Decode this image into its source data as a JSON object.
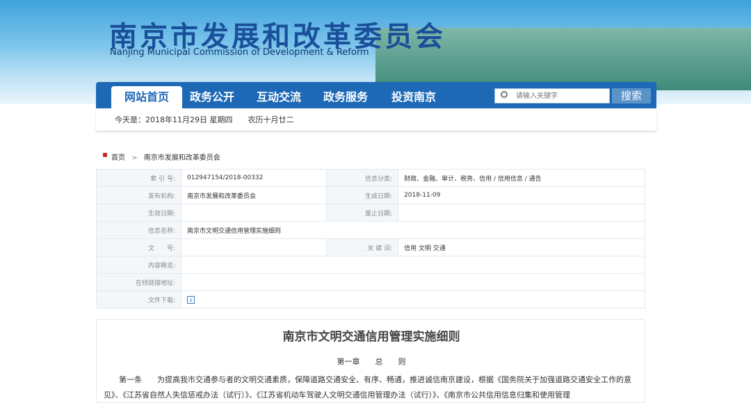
{
  "header": {
    "title": "南京市发展和改革委员会",
    "subtitle": "Nanjing Municipal Commission of Development & Reform"
  },
  "nav": [
    "网站首页",
    "政务公开",
    "互动交流",
    "政务服务",
    "投资南京"
  ],
  "search": {
    "placeholder": "请输入关键字",
    "button": "搜索"
  },
  "date": "今天是：2018年11月29日 星期四　　农历十月廿二",
  "breadcrumb": [
    "首页",
    "南京市发展和改革委员会"
  ],
  "meta": {
    "labels": [
      "索 引 号:",
      "发布机构:",
      "生效日期:",
      "信息名称:",
      "文　　号:",
      "内容概览:",
      "在线链接地址:",
      "文件下载:",
      "信息分类:",
      "生成日期:",
      "废止日期:",
      "关 键 词:"
    ],
    "values": [
      "012947154/2018-00332",
      "南京市发展和改革委员会",
      "",
      "南京市文明交通信用管理实施细则",
      "",
      "",
      "",
      "",
      "财政、金融、审计、税务、信用 / 信用信息 / 通告",
      "2018-11-09",
      "",
      "信用 文明 交通"
    ]
  },
  "article": {
    "title": "南京市文明交通信用管理实施细则",
    "chapter": "第一章　　总　　则",
    "para": "第一条　　为提高我市交通参与者的文明交通素质，保障道路交通安全、有序、畅通，推进诚信南京建设，根据《国务院关于加强道路交通安全工作的意见》、《江苏省自然人失信惩戒办法（试行）》、《江苏省机动车驾驶人文明交通信用管理办法（试行）》、《南京市公共信用信息归集和使用管理"
  }
}
